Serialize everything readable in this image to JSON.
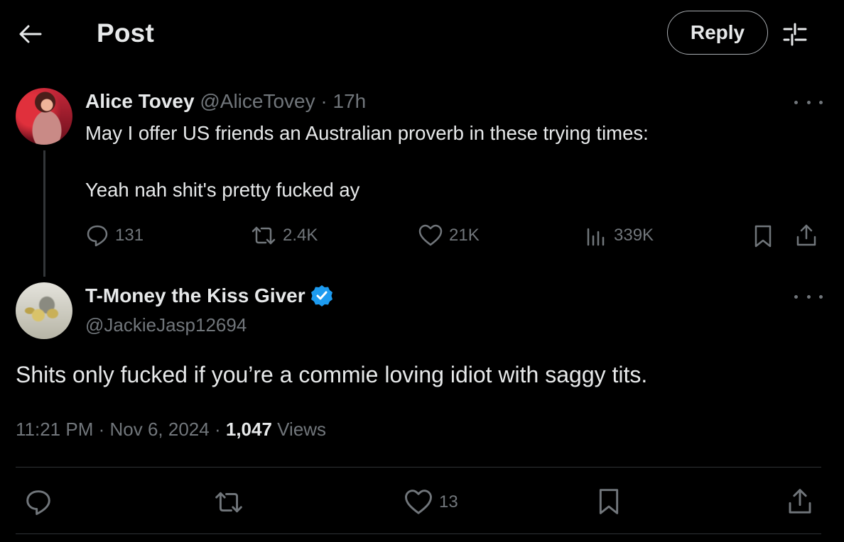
{
  "header": {
    "title": "Post",
    "reply_label": "Reply",
    "back_icon": "arrow-left-icon",
    "settings_icon": "sliders-icon"
  },
  "original_post": {
    "author_name": "Alice Tovey",
    "handle": "@AliceTovey",
    "separator": "·",
    "time": "17h",
    "text_line1": "May I offer US friends an Australian proverb in these trying times:",
    "text_line2": "Yeah nah shit's pretty fucked ay",
    "stats": {
      "replies": "131",
      "reposts": "2.4K",
      "likes": "21K",
      "views": "339K"
    }
  },
  "reply_post": {
    "author_name": "T-Money the Kiss Giver",
    "verified": true,
    "handle": "@JackieJasp12694",
    "text": "Shits only fucked if you’re a commie loving idiot with saggy tits.",
    "time": "11:21 PM",
    "date": "Nov 6, 2024",
    "sep": "·",
    "views_count": "1,047",
    "views_label": "Views",
    "stats": {
      "likes": "13"
    }
  },
  "colors": {
    "background": "#000000",
    "text_primary": "#e7e9ea",
    "text_muted": "#71767b",
    "verified_blue": "#1d9bf0",
    "divider": "#2f3336"
  }
}
